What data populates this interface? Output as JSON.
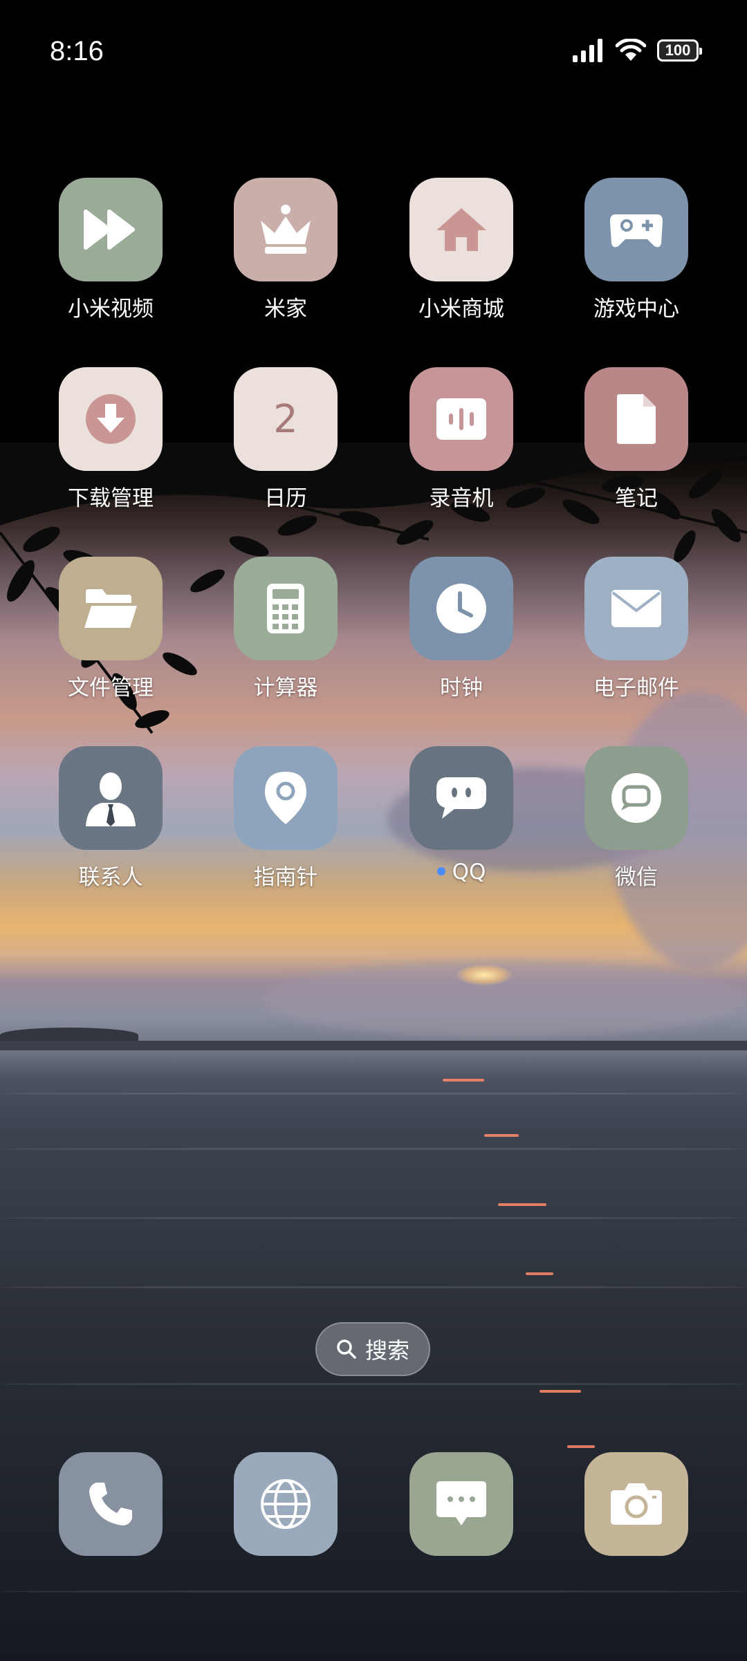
{
  "status_bar": {
    "time": "8:16",
    "battery": "100"
  },
  "apps": [
    {
      "label": "小米视频",
      "icon": "fast-forward-icon",
      "color": "#9aab98"
    },
    {
      "label": "米家",
      "icon": "crown-icon",
      "color": "#c9aeaa"
    },
    {
      "label": "小米商城",
      "icon": "home-icon",
      "color": "#ece0dd"
    },
    {
      "label": "游戏中心",
      "icon": "gamepad-icon",
      "color": "#7d92ab"
    },
    {
      "label": "下载管理",
      "icon": "download-icon",
      "color": "#ece0dd"
    },
    {
      "label": "日历",
      "icon": "calendar-icon",
      "color": "#ece0dd",
      "day": "2"
    },
    {
      "label": "录音机",
      "icon": "recorder-icon",
      "color": "#c69597"
    },
    {
      "label": "笔记",
      "icon": "note-icon",
      "color": "#b98787"
    },
    {
      "label": "文件管理",
      "icon": "folder-icon",
      "color": "#bfae90"
    },
    {
      "label": "计算器",
      "icon": "calculator-icon",
      "color": "#9aab98"
    },
    {
      "label": "时钟",
      "icon": "clock-icon",
      "color": "#7d92ab"
    },
    {
      "label": "电子邮件",
      "icon": "mail-icon",
      "color": "#9eb0c3"
    },
    {
      "label": "联系人",
      "icon": "contact-icon",
      "color": "#6b7684"
    },
    {
      "label": "指南针",
      "icon": "location-pin-icon",
      "color": "#8ea4bc"
    },
    {
      "label": "QQ",
      "icon": "chat-bubble-icon",
      "color": "#677380",
      "has_notification_dot": true
    },
    {
      "label": "微信",
      "icon": "wechat-icon",
      "color": "#8d9e8e"
    }
  ],
  "search": {
    "label": "搜索"
  },
  "dock": [
    {
      "icon": "phone-icon",
      "color": "#8791a0"
    },
    {
      "icon": "globe-icon",
      "color": "#9aa9bb"
    },
    {
      "icon": "message-icon",
      "color": "#98a692"
    },
    {
      "icon": "camera-icon",
      "color": "#c4b598"
    }
  ]
}
